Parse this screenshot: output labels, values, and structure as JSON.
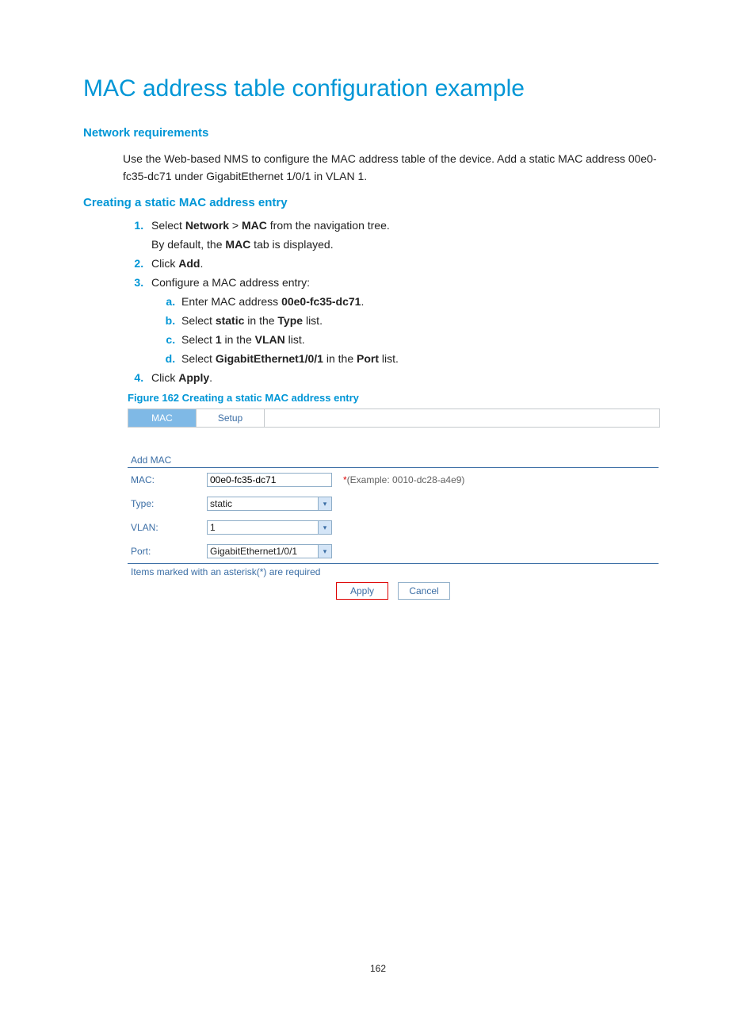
{
  "title": "MAC address table configuration example",
  "sections": {
    "req": {
      "heading": "Network requirements",
      "body": "Use the Web-based NMS to configure the MAC address table of the device. Add a static MAC address 00e0-fc35-dc71 under GigabitEthernet 1/0/1 in VLAN 1."
    },
    "create": {
      "heading": "Creating a static MAC address entry",
      "steps": {
        "s1a": "Select ",
        "s1b": "Network",
        "s1c": " > ",
        "s1d": "MAC",
        "s1e": " from the navigation tree.",
        "s1_sub": "By default, the ",
        "s1_sub_b": "MAC",
        "s1_sub_c": " tab is displayed.",
        "s2a": "Click ",
        "s2b": "Add",
        "s2c": ".",
        "s3": "Configure a MAC address entry:",
        "s3a1": "Enter MAC address ",
        "s3a2": "00e0-fc35-dc71",
        "s3a3": ".",
        "s3b1": "Select ",
        "s3b2": "static",
        "s3b3": " in the ",
        "s3b4": "Type",
        "s3b5": " list.",
        "s3c1": "Select ",
        "s3c2": "1",
        "s3c3": " in the ",
        "s3c4": "VLAN",
        "s3c5": " list.",
        "s3d1": "Select ",
        "s3d2": "GigabitEthernet1/0/1",
        "s3d3": " in the ",
        "s3d4": "Port",
        "s3d5": " list.",
        "s4a": "Click ",
        "s4b": "Apply",
        "s4c": "."
      },
      "figure_caption": "Figure 162 Creating a static MAC address entry"
    }
  },
  "figure": {
    "tabs": {
      "active": "MAC",
      "other": "Setup"
    },
    "panel_title": "Add MAC",
    "rows": {
      "mac": {
        "label": "MAC:",
        "value": "00e0-fc35-dc71",
        "hint_star": "*",
        "hint": "(Example: 0010-dc28-a4e9)"
      },
      "type": {
        "label": "Type:",
        "value": "static"
      },
      "vlan": {
        "label": "VLAN:",
        "value": "1"
      },
      "port": {
        "label": "Port:",
        "value": "GigabitEthernet1/0/1"
      }
    },
    "note": "Items marked with an asterisk(*) are required",
    "buttons": {
      "apply": "Apply",
      "cancel": "Cancel"
    }
  },
  "page_number": "162"
}
